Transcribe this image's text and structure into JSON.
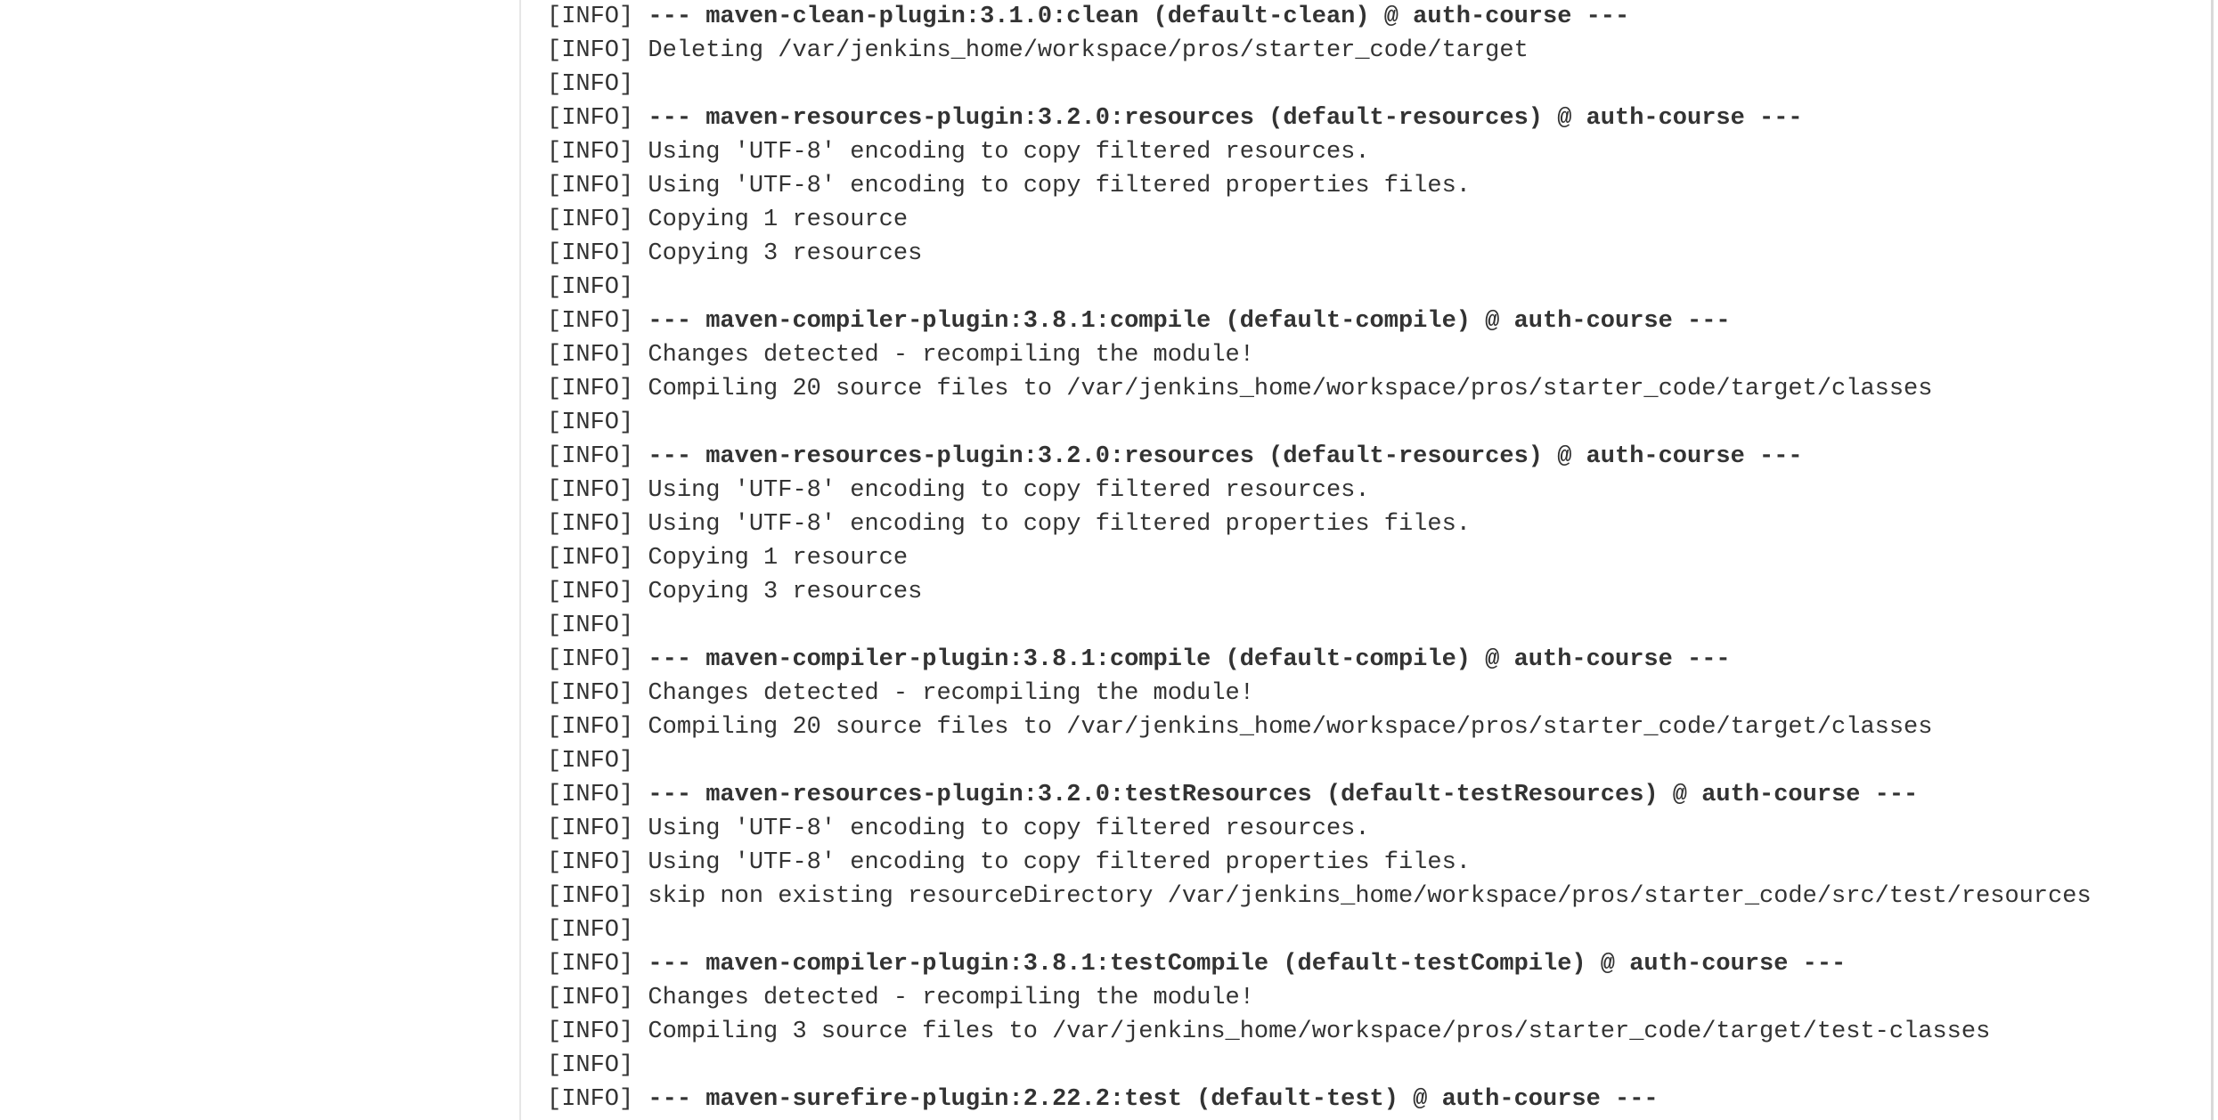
{
  "console": {
    "lines": [
      {
        "prefix": "[INFO] ",
        "text": "--- maven-clean-plugin:3.1.0:clean (default-clean) @ auth-course ---",
        "bold": true
      },
      {
        "prefix": "[INFO] ",
        "text": "Deleting /var/jenkins_home/workspace/pros/starter_code/target",
        "bold": false
      },
      {
        "prefix": "[INFO]",
        "text": "",
        "bold": false
      },
      {
        "prefix": "[INFO] ",
        "text": "--- maven-resources-plugin:3.2.0:resources (default-resources) @ auth-course ---",
        "bold": true
      },
      {
        "prefix": "[INFO] ",
        "text": "Using 'UTF-8' encoding to copy filtered resources.",
        "bold": false
      },
      {
        "prefix": "[INFO] ",
        "text": "Using 'UTF-8' encoding to copy filtered properties files.",
        "bold": false
      },
      {
        "prefix": "[INFO] ",
        "text": "Copying 1 resource",
        "bold": false
      },
      {
        "prefix": "[INFO] ",
        "text": "Copying 3 resources",
        "bold": false
      },
      {
        "prefix": "[INFO]",
        "text": "",
        "bold": false
      },
      {
        "prefix": "[INFO] ",
        "text": "--- maven-compiler-plugin:3.8.1:compile (default-compile) @ auth-course ---",
        "bold": true
      },
      {
        "prefix": "[INFO] ",
        "text": "Changes detected - recompiling the module!",
        "bold": false
      },
      {
        "prefix": "[INFO] ",
        "text": "Compiling 20 source files to /var/jenkins_home/workspace/pros/starter_code/target/classes",
        "bold": false
      },
      {
        "prefix": "[INFO]",
        "text": "",
        "bold": false
      },
      {
        "prefix": "[INFO] ",
        "text": "--- maven-resources-plugin:3.2.0:resources (default-resources) @ auth-course ---",
        "bold": true
      },
      {
        "prefix": "[INFO] ",
        "text": "Using 'UTF-8' encoding to copy filtered resources.",
        "bold": false
      },
      {
        "prefix": "[INFO] ",
        "text": "Using 'UTF-8' encoding to copy filtered properties files.",
        "bold": false
      },
      {
        "prefix": "[INFO] ",
        "text": "Copying 1 resource",
        "bold": false
      },
      {
        "prefix": "[INFO] ",
        "text": "Copying 3 resources",
        "bold": false
      },
      {
        "prefix": "[INFO]",
        "text": "",
        "bold": false
      },
      {
        "prefix": "[INFO] ",
        "text": "--- maven-compiler-plugin:3.8.1:compile (default-compile) @ auth-course ---",
        "bold": true
      },
      {
        "prefix": "[INFO] ",
        "text": "Changes detected - recompiling the module!",
        "bold": false
      },
      {
        "prefix": "[INFO] ",
        "text": "Compiling 20 source files to /var/jenkins_home/workspace/pros/starter_code/target/classes",
        "bold": false
      },
      {
        "prefix": "[INFO]",
        "text": "",
        "bold": false
      },
      {
        "prefix": "[INFO] ",
        "text": "--- maven-resources-plugin:3.2.0:testResources (default-testResources) @ auth-course ---",
        "bold": true
      },
      {
        "prefix": "[INFO] ",
        "text": "Using 'UTF-8' encoding to copy filtered resources.",
        "bold": false
      },
      {
        "prefix": "[INFO] ",
        "text": "Using 'UTF-8' encoding to copy filtered properties files.",
        "bold": false
      },
      {
        "prefix": "[INFO] ",
        "text": "skip non existing resourceDirectory /var/jenkins_home/workspace/pros/starter_code/src/test/resources",
        "bold": false
      },
      {
        "prefix": "[INFO]",
        "text": "",
        "bold": false
      },
      {
        "prefix": "[INFO] ",
        "text": "--- maven-compiler-plugin:3.8.1:testCompile (default-testCompile) @ auth-course ---",
        "bold": true
      },
      {
        "prefix": "[INFO] ",
        "text": "Changes detected - recompiling the module!",
        "bold": false
      },
      {
        "prefix": "[INFO] ",
        "text": "Compiling 3 source files to /var/jenkins_home/workspace/pros/starter_code/target/test-classes",
        "bold": false
      },
      {
        "prefix": "[INFO]",
        "text": "",
        "bold": false
      },
      {
        "prefix": "[INFO] ",
        "text": "--- maven-surefire-plugin:2.22.2:test (default-test) @ auth-course ---",
        "bold": true
      }
    ]
  }
}
